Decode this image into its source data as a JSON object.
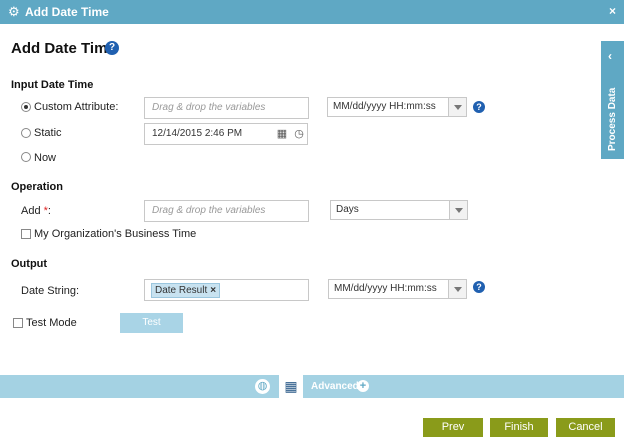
{
  "window": {
    "title": "Add Date Time",
    "close_label": "×"
  },
  "page": {
    "title": "Add Date Time",
    "help_label": "?"
  },
  "input_date_time": {
    "section": "Input Date Time",
    "custom_attribute": {
      "label": "Custom Attribute:",
      "placeholder": "Drag & drop the variables",
      "format": "MM/dd/yyyy HH:mm:ss",
      "selected": true
    },
    "static": {
      "label": "Static",
      "value": "12/14/2015 2:46 PM"
    },
    "now": {
      "label": "Now"
    }
  },
  "operation": {
    "section": "Operation",
    "add": {
      "label": "Add ",
      "required": "*",
      "colon": ":",
      "placeholder": "Drag & drop the variables",
      "unit": "Days"
    },
    "business_time": {
      "label": "My Organization's Business Time"
    }
  },
  "output": {
    "section": "Output",
    "date_string": {
      "label": "Date String:",
      "tag": "Date Result",
      "tag_remove": "×",
      "format": "MM/dd/yyyy HH:mm:ss"
    }
  },
  "test_mode": {
    "label": "Test Mode",
    "button": "Test"
  },
  "side_tab": {
    "label": "Process Data"
  },
  "bottom_bar": {
    "advanced_label": "Advanced"
  },
  "footer": {
    "prev": "Prev",
    "finish": "Finish",
    "cancel": "Cancel"
  }
}
